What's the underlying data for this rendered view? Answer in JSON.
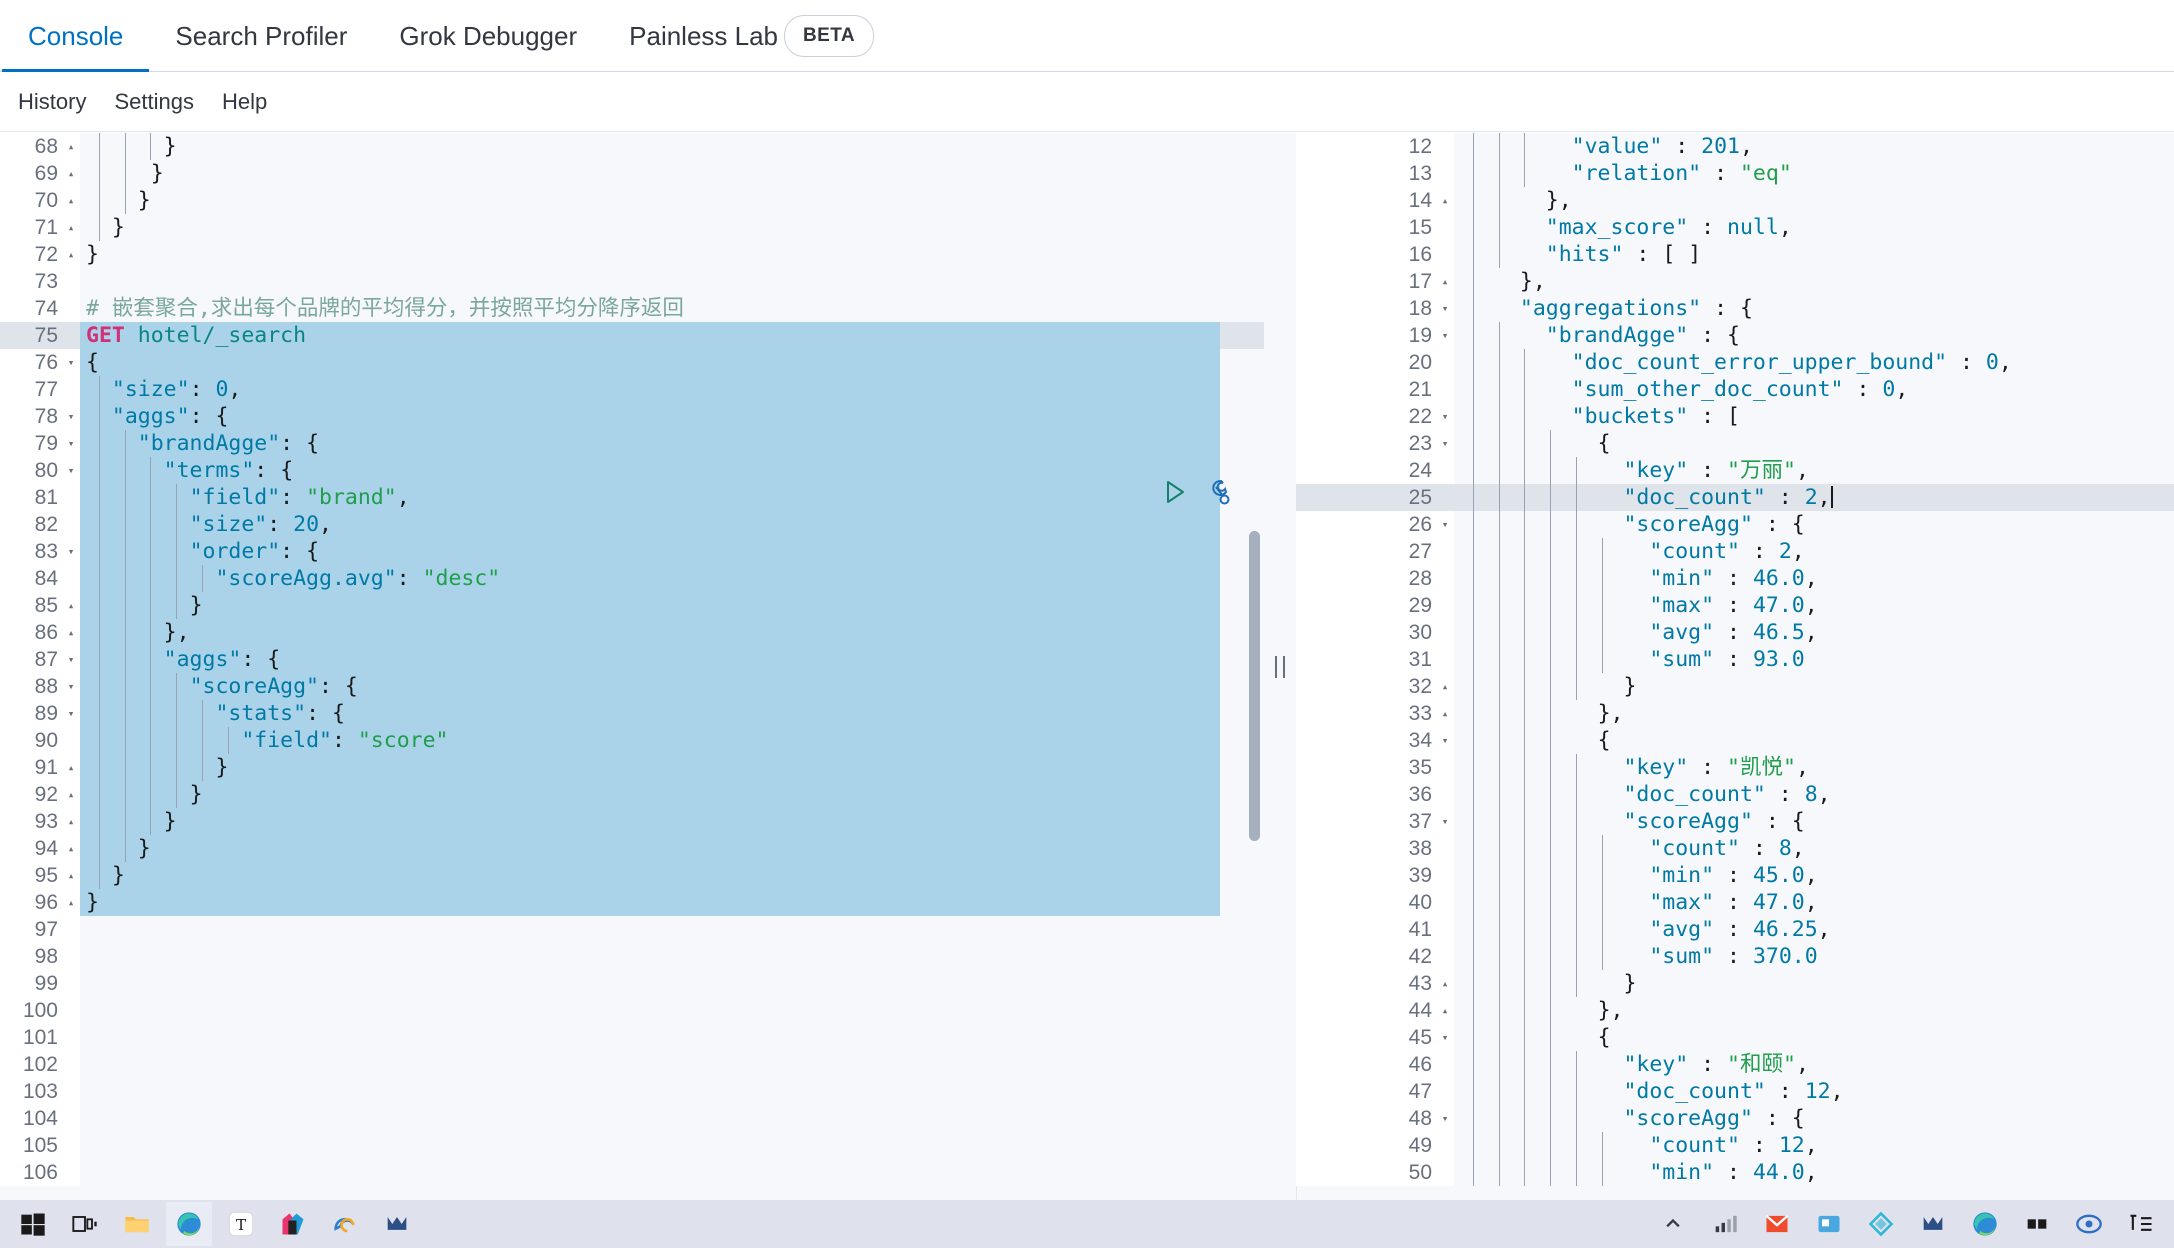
{
  "app": {
    "name": "Kibana Dev Tools Console"
  },
  "tabs": [
    {
      "label": "Console",
      "active": true
    },
    {
      "label": "Search Profiler",
      "active": false
    },
    {
      "label": "Grok Debugger",
      "active": false
    },
    {
      "label": "Painless Lab",
      "active": false
    }
  ],
  "beta_badge": "BETA",
  "menu": [
    {
      "label": "History"
    },
    {
      "label": "Settings"
    },
    {
      "label": "Help"
    }
  ],
  "colors": {
    "accent": "#0071c2",
    "string": "#1f9e4b",
    "key": "#0079a5",
    "method": "#d13076",
    "comment": "#7aa79c",
    "selection": "#aad3e9",
    "highlight_line": "#dfe3ea",
    "taskbar": "#dfe2ec"
  },
  "editor": {
    "first_line": 68,
    "selected_range": [
      75,
      96
    ],
    "cursor_line": 75,
    "lines": [
      {
        "n": 68,
        "fold": "up",
        "text": "      }"
      },
      {
        "n": 69,
        "fold": "up",
        "text": "     }"
      },
      {
        "n": 70,
        "fold": "up",
        "text": "    }"
      },
      {
        "n": 71,
        "fold": "up",
        "text": "  }"
      },
      {
        "n": 72,
        "fold": "up",
        "text": "}"
      },
      {
        "n": 73,
        "fold": "",
        "text": ""
      },
      {
        "n": 74,
        "fold": "",
        "text": "# 嵌套聚合,求出每个品牌的平均得分，并按照平均分降序返回"
      },
      {
        "n": 75,
        "fold": "",
        "text": "GET hotel/_search"
      },
      {
        "n": 76,
        "fold": "down",
        "text": "{"
      },
      {
        "n": 77,
        "fold": "",
        "text": "  \"size\": 0,"
      },
      {
        "n": 78,
        "fold": "down",
        "text": "  \"aggs\": {"
      },
      {
        "n": 79,
        "fold": "down",
        "text": "    \"brandAgge\": {"
      },
      {
        "n": 80,
        "fold": "down",
        "text": "      \"terms\": {"
      },
      {
        "n": 81,
        "fold": "",
        "text": "        \"field\": \"brand\","
      },
      {
        "n": 82,
        "fold": "",
        "text": "        \"size\": 20,"
      },
      {
        "n": 83,
        "fold": "down",
        "text": "        \"order\": {"
      },
      {
        "n": 84,
        "fold": "",
        "text": "          \"scoreAgg.avg\": \"desc\""
      },
      {
        "n": 85,
        "fold": "up",
        "text": "        }"
      },
      {
        "n": 86,
        "fold": "up",
        "text": "      },"
      },
      {
        "n": 87,
        "fold": "down",
        "text": "      \"aggs\": {"
      },
      {
        "n": 88,
        "fold": "down",
        "text": "        \"scoreAgg\": {"
      },
      {
        "n": 89,
        "fold": "down",
        "text": "          \"stats\": {"
      },
      {
        "n": 90,
        "fold": "",
        "text": "            \"field\": \"score\""
      },
      {
        "n": 91,
        "fold": "up",
        "text": "          }"
      },
      {
        "n": 92,
        "fold": "up",
        "text": "        }"
      },
      {
        "n": 93,
        "fold": "up",
        "text": "      }"
      },
      {
        "n": 94,
        "fold": "up",
        "text": "    }"
      },
      {
        "n": 95,
        "fold": "up",
        "text": "  }"
      },
      {
        "n": 96,
        "fold": "up",
        "text": "}"
      },
      {
        "n": 97,
        "fold": "",
        "text": ""
      },
      {
        "n": 98,
        "fold": "",
        "text": ""
      },
      {
        "n": 99,
        "fold": "",
        "text": ""
      },
      {
        "n": 100,
        "fold": "",
        "text": ""
      },
      {
        "n": 101,
        "fold": "",
        "text": ""
      },
      {
        "n": 102,
        "fold": "",
        "text": ""
      },
      {
        "n": 103,
        "fold": "",
        "text": ""
      },
      {
        "n": 104,
        "fold": "",
        "text": ""
      },
      {
        "n": 105,
        "fold": "",
        "text": ""
      },
      {
        "n": 106,
        "fold": "",
        "text": ""
      }
    ],
    "actions": {
      "run_label": "play-icon",
      "docs_label": "wrench-icon"
    }
  },
  "response": {
    "first_line": 12,
    "highlight_line": 25,
    "lines": [
      {
        "n": 12,
        "fold": "",
        "text": "      \"value\" : 201,"
      },
      {
        "n": 13,
        "fold": "",
        "text": "      \"relation\" : \"eq\""
      },
      {
        "n": 14,
        "fold": "up",
        "text": "    },"
      },
      {
        "n": 15,
        "fold": "",
        "text": "    \"max_score\" : null,"
      },
      {
        "n": 16,
        "fold": "",
        "text": "    \"hits\" : [ ]"
      },
      {
        "n": 17,
        "fold": "up",
        "text": "  },"
      },
      {
        "n": 18,
        "fold": "down",
        "text": "  \"aggregations\" : {"
      },
      {
        "n": 19,
        "fold": "down",
        "text": "    \"brandAgge\" : {"
      },
      {
        "n": 20,
        "fold": "",
        "text": "      \"doc_count_error_upper_bound\" : 0,"
      },
      {
        "n": 21,
        "fold": "",
        "text": "      \"sum_other_doc_count\" : 0,"
      },
      {
        "n": 22,
        "fold": "down",
        "text": "      \"buckets\" : ["
      },
      {
        "n": 23,
        "fold": "down",
        "text": "        {"
      },
      {
        "n": 24,
        "fold": "",
        "text": "          \"key\" : \"万丽\","
      },
      {
        "n": 25,
        "fold": "",
        "text": "          \"doc_count\" : 2,"
      },
      {
        "n": 26,
        "fold": "down",
        "text": "          \"scoreAgg\" : {"
      },
      {
        "n": 27,
        "fold": "",
        "text": "            \"count\" : 2,"
      },
      {
        "n": 28,
        "fold": "",
        "text": "            \"min\" : 46.0,"
      },
      {
        "n": 29,
        "fold": "",
        "text": "            \"max\" : 47.0,"
      },
      {
        "n": 30,
        "fold": "",
        "text": "            \"avg\" : 46.5,"
      },
      {
        "n": 31,
        "fold": "",
        "text": "            \"sum\" : 93.0"
      },
      {
        "n": 32,
        "fold": "up",
        "text": "          }"
      },
      {
        "n": 33,
        "fold": "up",
        "text": "        },"
      },
      {
        "n": 34,
        "fold": "down",
        "text": "        {"
      },
      {
        "n": 35,
        "fold": "",
        "text": "          \"key\" : \"凯悦\","
      },
      {
        "n": 36,
        "fold": "",
        "text": "          \"doc_count\" : 8,"
      },
      {
        "n": 37,
        "fold": "down",
        "text": "          \"scoreAgg\" : {"
      },
      {
        "n": 38,
        "fold": "",
        "text": "            \"count\" : 8,"
      },
      {
        "n": 39,
        "fold": "",
        "text": "            \"min\" : 45.0,"
      },
      {
        "n": 40,
        "fold": "",
        "text": "            \"max\" : 47.0,"
      },
      {
        "n": 41,
        "fold": "",
        "text": "            \"avg\" : 46.25,"
      },
      {
        "n": 42,
        "fold": "",
        "text": "            \"sum\" : 370.0"
      },
      {
        "n": 43,
        "fold": "up",
        "text": "          }"
      },
      {
        "n": 44,
        "fold": "up",
        "text": "        },"
      },
      {
        "n": 45,
        "fold": "down",
        "text": "        {"
      },
      {
        "n": 46,
        "fold": "",
        "text": "          \"key\" : \"和颐\","
      },
      {
        "n": 47,
        "fold": "",
        "text": "          \"doc_count\" : 12,"
      },
      {
        "n": 48,
        "fold": "down",
        "text": "          \"scoreAgg\" : {"
      },
      {
        "n": 49,
        "fold": "",
        "text": "            \"count\" : 12,"
      },
      {
        "n": 50,
        "fold": "",
        "text": "            \"min\" : 44.0,"
      }
    ]
  },
  "taskbar": {
    "left_items": [
      {
        "name": "start-button",
        "glyph": "windows"
      },
      {
        "name": "task-view-button",
        "glyph": "taskview"
      },
      {
        "name": "file-explorer-button",
        "glyph": "folder"
      },
      {
        "name": "edge-browser-button",
        "glyph": "edge"
      },
      {
        "name": "text-editor-button",
        "glyph": "typora"
      },
      {
        "name": "app-colorful-button",
        "glyph": "colorapp"
      },
      {
        "name": "legacy-edge-button",
        "glyph": "edge-legacy"
      },
      {
        "name": "navicat-button",
        "glyph": "navicat"
      }
    ],
    "right_items": [
      {
        "name": "tray-chevron-icon",
        "glyph": "chevron"
      },
      {
        "name": "tray-network-icon",
        "glyph": "network"
      },
      {
        "name": "foxmail-icon",
        "glyph": "foxmail"
      },
      {
        "name": "wechat-files-icon",
        "glyph": "bluefile"
      },
      {
        "name": "xmind-icon",
        "glyph": "xmind"
      },
      {
        "name": "navicat-tray-icon",
        "glyph": "navicat"
      },
      {
        "name": "edge-tray-icon",
        "glyph": "edge"
      },
      {
        "name": "grid-icon",
        "glyph": "grid"
      },
      {
        "name": "security-icon",
        "glyph": "shield"
      },
      {
        "name": "ime-icon",
        "glyph": "ime"
      }
    ]
  }
}
